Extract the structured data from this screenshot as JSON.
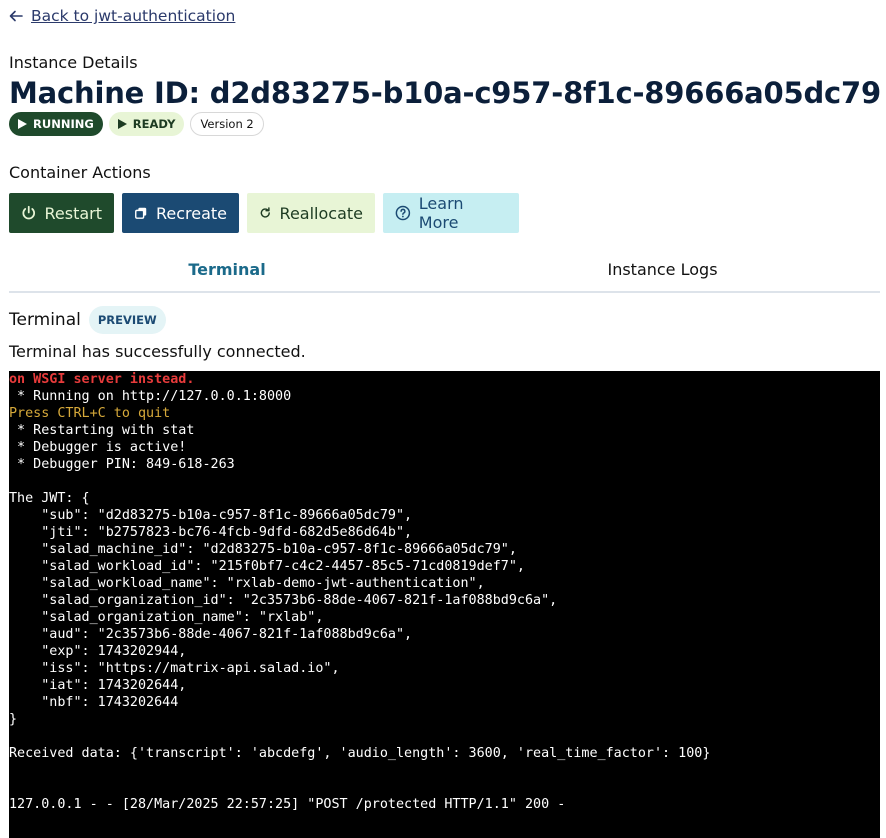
{
  "nav": {
    "back_label": "Back to jwt-authentication"
  },
  "header": {
    "section_label": "Instance Details",
    "machine_title": "Machine ID: d2d83275-b10a-c957-8f1c-89666a05dc79",
    "badges": {
      "running": "RUNNING",
      "ready": "READY",
      "version": "Version 2"
    }
  },
  "actions": {
    "heading": "Container Actions",
    "restart": "Restart",
    "recreate": "Recreate",
    "reallocate": "Reallocate",
    "learn_more": "Learn More"
  },
  "tabs": {
    "terminal": "Terminal",
    "logs": "Instance Logs"
  },
  "terminal": {
    "title": "Terminal",
    "preview_badge": "PREVIEW",
    "status": "Terminal has successfully connected.",
    "lines": [
      "on WSGI server instead.",
      " * Running on http://127.0.0.1:8000",
      "Press CTRL+C to quit",
      " * Restarting with stat",
      " * Debugger is active!",
      " * Debugger PIN: 849-618-263",
      "",
      "The JWT: {",
      "    \"sub\": \"d2d83275-b10a-c957-8f1c-89666a05dc79\",",
      "    \"jti\": \"b2757823-bc76-4fcb-9dfd-682d5e86d64b\",",
      "    \"salad_machine_id\": \"d2d83275-b10a-c957-8f1c-89666a05dc79\",",
      "    \"salad_workload_id\": \"215f0bf7-c4c2-4457-85c5-71cd0819def7\",",
      "    \"salad_workload_name\": \"rxlab-demo-jwt-authentication\",",
      "    \"salad_organization_id\": \"2c3573b6-88de-4067-821f-1af088bd9c6a\",",
      "    \"salad_organization_name\": \"rxlab\",",
      "    \"aud\": \"2c3573b6-88de-4067-821f-1af088bd9c6a\",",
      "    \"exp\": 1743202944,",
      "    \"iss\": \"https://matrix-api.salad.io\",",
      "    \"iat\": 1743202644,",
      "    \"nbf\": 1743202644",
      "}",
      "",
      "Received data: {'transcript': 'abcdefg', 'audio_length': 3600, 'real_time_factor': 100}",
      "",
      "",
      "127.0.0.1 - - [28/Mar/2025 22:57:25] \"POST /protected HTTP/1.1\" 200 -"
    ]
  },
  "colors": {
    "running_bg": "#1f4a2c",
    "ready_bg": "#e8f5d6",
    "recreate_bg": "#1b4a73",
    "learn_bg": "#c6eef2",
    "active_tab": "#1b6a8a",
    "terminal_bg": "#000000",
    "terminal_error": "#e83b3b",
    "terminal_warn": "#d6a93a"
  }
}
